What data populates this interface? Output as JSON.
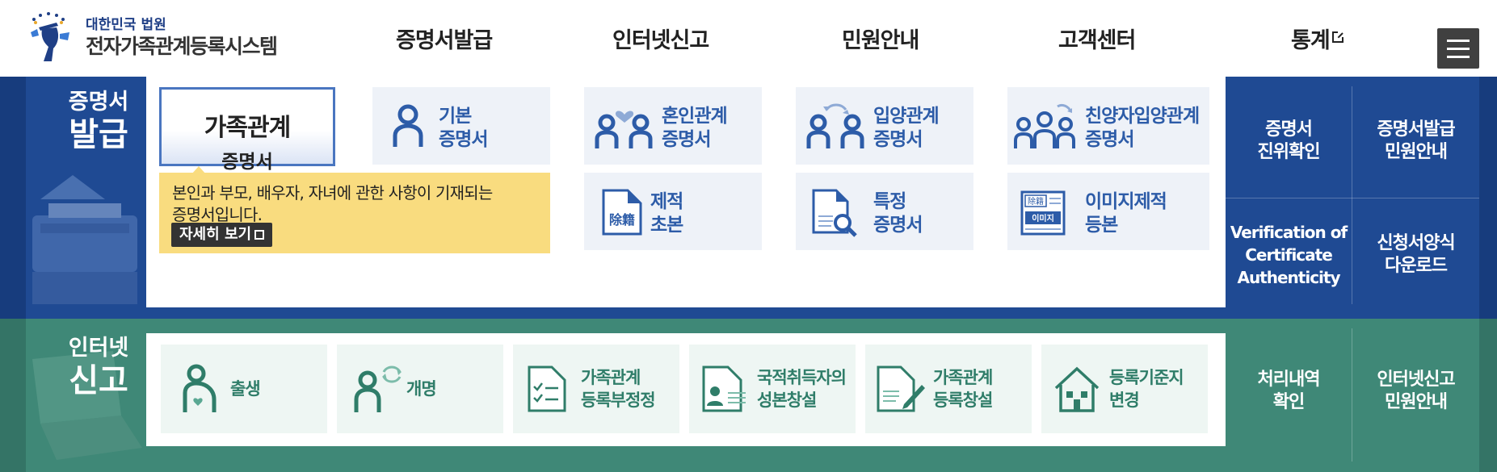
{
  "header": {
    "logo_sub": "대한민국 법원",
    "logo_main": "전자가족관계등록시스템",
    "nav": [
      "증명서발급",
      "인터넷신고",
      "민원안내",
      "고객센터",
      "통계"
    ],
    "menu_icon": "hamburger-menu-icon"
  },
  "certificate": {
    "title_small": "증명서",
    "title_large": "발급",
    "active_tile": {
      "line1": "가족관계",
      "line2": "증명서"
    },
    "tiles": [
      {
        "line1": "기본",
        "line2": "증명서",
        "icon": "person-icon"
      },
      {
        "line1": "혼인관계",
        "line2": "증명서",
        "icon": "couple-heart-icon"
      },
      {
        "line1": "입양관계",
        "line2": "증명서",
        "icon": "adoption-arrows-icon"
      },
      {
        "line1": "친양자입양관계",
        "line2": "증명서",
        "icon": "family-adoption-icon"
      },
      {
        "line1": "제적",
        "line2": "초본",
        "icon": "document-stamp-icon",
        "icon_text": "除籍"
      },
      {
        "line1": "특정",
        "line2": "증명서",
        "icon": "document-search-icon"
      },
      {
        "line1": "이미지제적",
        "line2": "등본",
        "icon": "image-register-icon",
        "icon_text_top": "除籍",
        "icon_text_bottom": "이미지"
      }
    ],
    "description": {
      "line1": "본인과 부모, 배우자, 자녀에 관한 사항이 기재되는",
      "line2": "증명서입니다.",
      "more_label": "자세히 보기"
    },
    "side_links": [
      {
        "line1": "증명서",
        "line2": "진위확인"
      },
      {
        "line1": "증명서발급",
        "line2": "민원안내"
      },
      {
        "line1": "Verification of",
        "line2": "Certificate",
        "line3": "Authenticity"
      },
      {
        "line1": "신청서양식",
        "line2": "다운로드"
      }
    ],
    "colors": {
      "band": "#1f4a93",
      "tile_text": "#2d5ca8",
      "tile_bg": "#eef2f8",
      "desc_bg": "#f9dc7f"
    }
  },
  "report": {
    "title_small": "인터넷",
    "title_large": "신고",
    "tiles": [
      {
        "line1": "출생",
        "line2": "",
        "icon": "birth-icon"
      },
      {
        "line1": "개명",
        "line2": "",
        "icon": "rename-person-icon"
      },
      {
        "line1": "가족관계",
        "line2": "등록부정정",
        "icon": "checklist-document-icon"
      },
      {
        "line1": "국적취득자의",
        "line2": "성본창설",
        "icon": "id-document-icon"
      },
      {
        "line1": "가족관계",
        "line2": "등록창설",
        "icon": "document-pen-icon"
      },
      {
        "line1": "등록기준지",
        "line2": "변경",
        "icon": "house-icon"
      }
    ],
    "side_links": [
      {
        "line1": "처리내역",
        "line2": "확인"
      },
      {
        "line1": "인터넷신고",
        "line2": "민원안내"
      }
    ],
    "colors": {
      "band": "#3f8877",
      "tile_text": "#2f7d69",
      "tile_bg": "#eef6f3"
    }
  }
}
